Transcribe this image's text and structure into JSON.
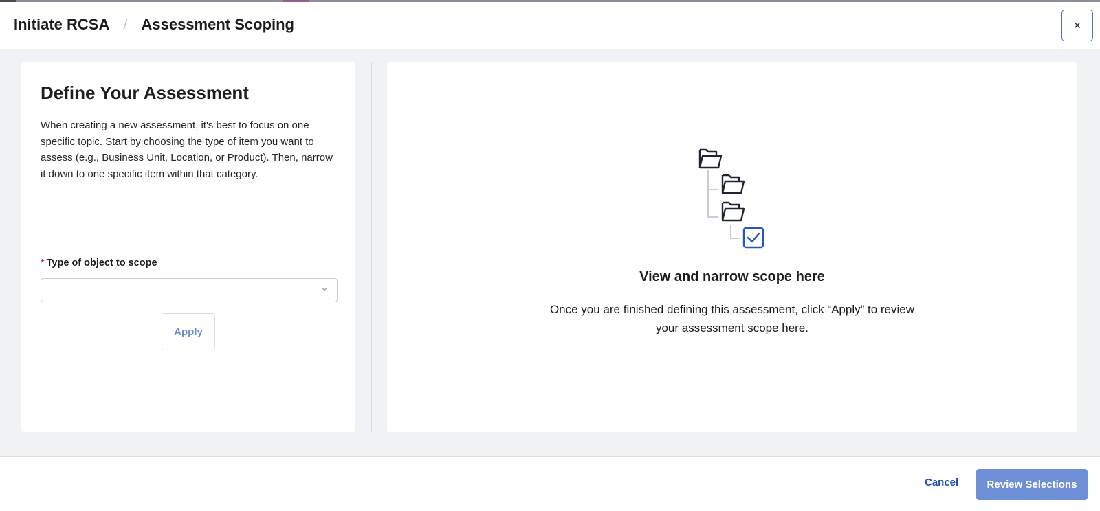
{
  "header": {
    "breadcrumb": [
      "Initiate RCSA",
      "Assessment Scoping"
    ],
    "separator": "/",
    "close_label": "×"
  },
  "left_panel": {
    "title": "Define Your Assessment",
    "description": "When creating a new assessment, it's best to focus on one specific topic. Start by choosing the type of item you want to assess (e.g., Business Unit, Location, or Product). Then, narrow it down to one specific item within that category.",
    "field": {
      "required_marker": "*",
      "label": "Type of object to scope",
      "value": ""
    },
    "apply_label": "Apply"
  },
  "right_panel": {
    "illustration_icon": "folder-tree-icon",
    "title": "View and narrow scope here",
    "description": "Once you are finished defining this assessment, click “Apply” to review your assessment scope here."
  },
  "footer": {
    "cancel_label": "Cancel",
    "review_label": "Review Selections"
  },
  "colors": {
    "accent": "#1f4fb4",
    "primary_button": "#6f8fd7",
    "required": "#d6337a",
    "background": "#f1f2f4"
  }
}
